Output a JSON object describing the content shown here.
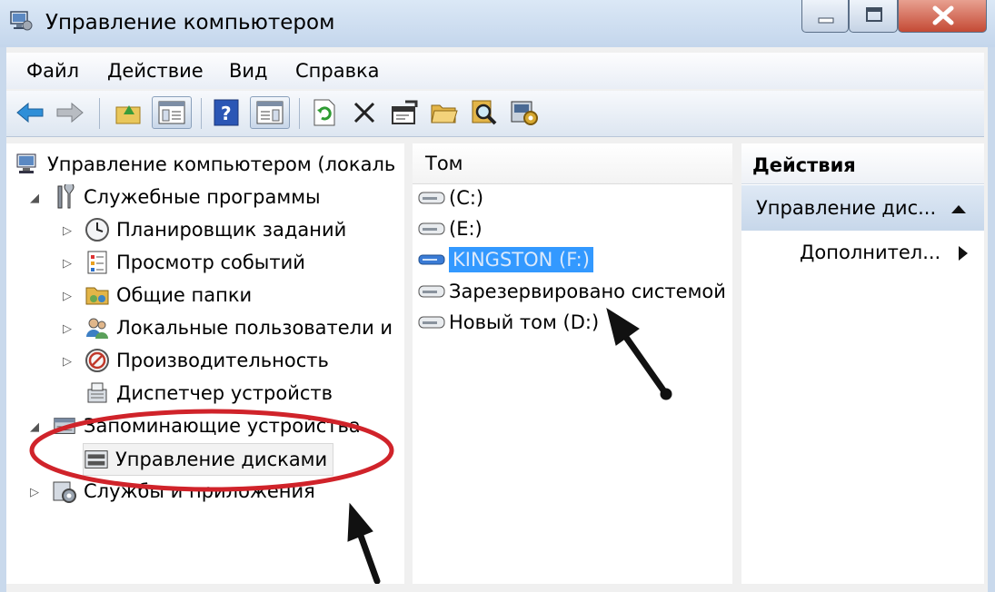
{
  "window": {
    "title": "Управление компьютером"
  },
  "menu": {
    "file": "Файл",
    "action": "Действие",
    "view": "Вид",
    "help": "Справка"
  },
  "toolbar": {
    "icons": [
      "back-icon",
      "forward-icon",
      "up-folder-icon",
      "show-tree-icon",
      "help-icon",
      "show-action-pane-icon",
      "refresh-icon",
      "delete-icon",
      "properties-icon",
      "open-icon",
      "search-icon",
      "disk-settings-icon"
    ]
  },
  "tree": {
    "root": "Управление компьютером (локаль",
    "system_tools": "Служебные программы",
    "task_scheduler": "Планировщик заданий",
    "event_viewer": "Просмотр событий",
    "shared_folders": "Общие папки",
    "local_users": "Локальные пользователи и",
    "performance": "Производительность",
    "device_manager": "Диспетчер устройств",
    "storage": "Запоминающие устройства",
    "disk_management": "Управление дисками",
    "services_apps": "Службы и приложения"
  },
  "volumes": {
    "header": "Том",
    "items": [
      "(C:)",
      "(E:)",
      "KINGSTON (F:)",
      "Зарезервировано системой",
      "Новый том (D:)"
    ],
    "selected_index": 2
  },
  "actions": {
    "header": "Действия",
    "group": "Управление дис...",
    "more": "Дополнител..."
  },
  "colors": {
    "selection": "#3399ff",
    "annotation_ellipse": "#d0232a",
    "annotation_arrow": "#111111",
    "title_bar": "#c4d6ec",
    "close_button": "#c44a35"
  }
}
